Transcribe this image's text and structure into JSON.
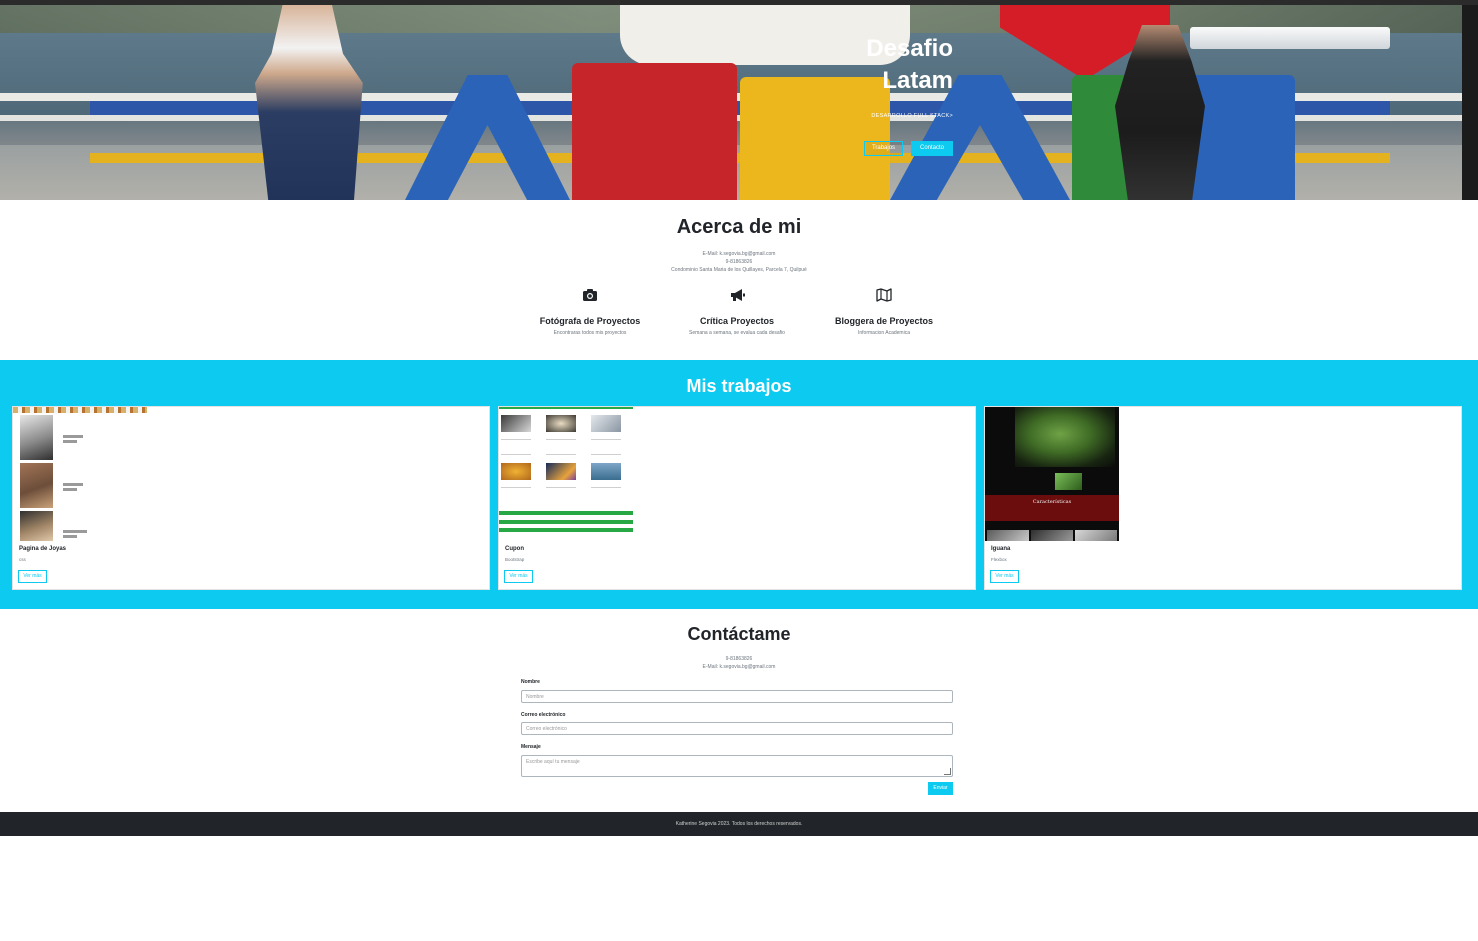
{
  "hero": {
    "title_line1": "Desafio",
    "title_line2": "Latam",
    "subtitle": "DESARROLLO FULL STACK>",
    "btn_works": "Trabajos",
    "btn_contact": "Contacto"
  },
  "about": {
    "title": "Acerca de mi",
    "email": "E-Mail: k.segovia.bg@gmail.com",
    "phone": "9-81863826",
    "address": "Condominio Santa Maria de los Quillayes, Parcela 7, Quilpué",
    "features": [
      {
        "icon": "camera-icon",
        "title": "Fotógrafa de Proyectos",
        "desc": "Encontraras todos mis proyectos"
      },
      {
        "icon": "megaphone-icon",
        "title": "Crítica Proyectos",
        "desc": "Semana a semana, se evalua cada desafio"
      },
      {
        "icon": "map-icon",
        "title": "Bloggera de Proyectos",
        "desc": "Informacion Academica"
      }
    ]
  },
  "works": {
    "title": "Mis trabajos",
    "cards": [
      {
        "title": "Pagina de Joyas",
        "tech": "css",
        "button": "Ver más"
      },
      {
        "title": "Cupon",
        "tech": "Bootstrap",
        "button": "Ver más"
      },
      {
        "title": "Iguana",
        "tech": "Flexbox",
        "button": "Ver más"
      }
    ],
    "thumb_text": "Características"
  },
  "contact": {
    "title": "Contáctame",
    "phone": "9-81863826",
    "email": "E-Mail: k.segovia.bg@gmail.com",
    "name_label": "Nombre",
    "name_placeholder": "Nombre",
    "email_label": "Correo electrónico",
    "email_placeholder": "Correo electrónico",
    "message_label": "Mensaje",
    "message_placeholder": "Escribe aquí tu mensaje",
    "send": "Enviar"
  },
  "footer": {
    "text": "Katherine Segovia 2023. Todos los derechos reservados."
  },
  "colors": {
    "accent": "#0dcaf0",
    "footer": "#212529",
    "green": "#28a745"
  }
}
